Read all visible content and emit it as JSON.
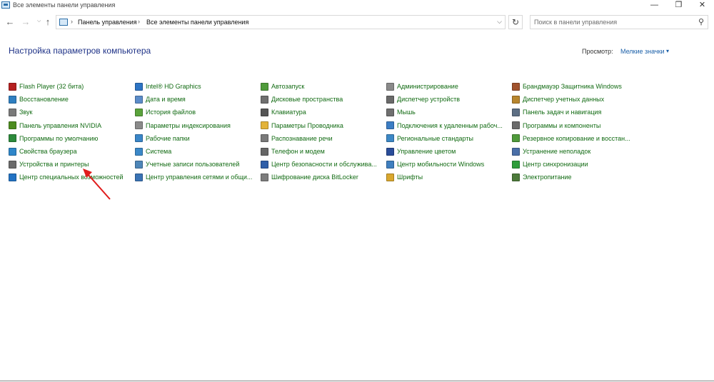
{
  "window": {
    "title": "Все элементы панели управления",
    "controls": {
      "minimize": "—",
      "maximize": "❐",
      "close": "✕"
    }
  },
  "nav": {
    "back": "←",
    "forward": "→",
    "recent": "⌵",
    "up": "↑"
  },
  "address": {
    "crumbs": [
      "Панель управления",
      "Все элементы панели управления"
    ],
    "separator": "›",
    "dropdown": "⌵",
    "refresh": "↻"
  },
  "search": {
    "placeholder": "Поиск в панели управления",
    "value": ""
  },
  "heading": "Настройка параметров компьютера",
  "view": {
    "label": "Просмотр:",
    "value": "Мелкие значки",
    "caret": "▾"
  },
  "columns": [
    {
      "items": [
        {
          "label": "Flash Player (32 бита)",
          "icon": "flash-icon",
          "color": "#b52020"
        },
        {
          "label": "Восстановление",
          "icon": "recovery-icon",
          "color": "#2f7fc1"
        },
        {
          "label": "Звук",
          "icon": "sound-icon",
          "color": "#7a7a7a"
        },
        {
          "label": "Панель управления NVIDIA",
          "icon": "nvidia-icon",
          "color": "#4c8c1f"
        },
        {
          "label": "Программы по умолчанию",
          "icon": "default-programs-icon",
          "color": "#2c8a3b"
        },
        {
          "label": "Свойства браузера",
          "icon": "browser-icon",
          "color": "#2e86c9"
        },
        {
          "label": "Устройства и принтеры",
          "icon": "printer-icon",
          "color": "#6b6b6b"
        },
        {
          "label": "Центр специальных возможностей",
          "icon": "accessibility-icon",
          "color": "#2272c3"
        }
      ]
    },
    {
      "items": [
        {
          "label": "Intel® HD Graphics",
          "icon": "intel-icon",
          "color": "#2d74c4"
        },
        {
          "label": "Дата и время",
          "icon": "clock-icon",
          "color": "#5b8cc9"
        },
        {
          "label": "История файлов",
          "icon": "file-history-icon",
          "color": "#5aa33b"
        },
        {
          "label": "Параметры индексирования",
          "icon": "indexing-icon",
          "color": "#8a8a8a"
        },
        {
          "label": "Рабочие папки",
          "icon": "work-folders-icon",
          "color": "#3a86c8"
        },
        {
          "label": "Система",
          "icon": "system-icon",
          "color": "#3b88c8"
        },
        {
          "label": "Учетные записи пользователей",
          "icon": "users-icon",
          "color": "#4e86b8"
        },
        {
          "label": "Центр управления сетями и общи...",
          "icon": "network-icon",
          "color": "#3a73b5"
        }
      ]
    },
    {
      "items": [
        {
          "label": "Автозапуск",
          "icon": "autoplay-icon",
          "color": "#4f9b3b"
        },
        {
          "label": "Дисковые пространства",
          "icon": "storage-icon",
          "color": "#6f6f6f"
        },
        {
          "label": "Клавиатура",
          "icon": "keyboard-icon",
          "color": "#555555"
        },
        {
          "label": "Параметры Проводника",
          "icon": "explorer-options-icon",
          "color": "#e3b33a"
        },
        {
          "label": "Распознавание речи",
          "icon": "microphone-icon",
          "color": "#7a7a7a"
        },
        {
          "label": "Телефон и модем",
          "icon": "phone-icon",
          "color": "#666666"
        },
        {
          "label": "Центр безопасности и обслужива...",
          "icon": "flag-icon",
          "color": "#2f5ea8"
        },
        {
          "label": "Шифрование диска BitLocker",
          "icon": "bitlocker-icon",
          "color": "#7d7d7d"
        }
      ]
    },
    {
      "items": [
        {
          "label": "Администрирование",
          "icon": "admin-tools-icon",
          "color": "#8a8a8a"
        },
        {
          "label": "Диспетчер устройств",
          "icon": "device-manager-icon",
          "color": "#6a6a6a"
        },
        {
          "label": "Мышь",
          "icon": "mouse-icon",
          "color": "#6f6f6f"
        },
        {
          "label": "Подключения к удаленным рабоч...",
          "icon": "remoteapp-icon",
          "color": "#3b7dc4"
        },
        {
          "label": "Региональные стандарты",
          "icon": "region-icon",
          "color": "#3c88c6"
        },
        {
          "label": "Управление цветом",
          "icon": "color-management-icon",
          "color": "#2a4d9a"
        },
        {
          "label": "Центр мобильности Windows",
          "icon": "mobility-icon",
          "color": "#3f7fbf"
        },
        {
          "label": "Шрифты",
          "icon": "fonts-icon",
          "color": "#d9a72e"
        }
      ]
    },
    {
      "items": [
        {
          "label": "Брандмауэр Защитника Windows",
          "icon": "firewall-icon",
          "color": "#a0522d"
        },
        {
          "label": "Диспетчер учетных данных",
          "icon": "credential-icon",
          "color": "#b8862e"
        },
        {
          "label": "Панель задач и навигация",
          "icon": "taskbar-icon",
          "color": "#5d6f84"
        },
        {
          "label": "Программы и компоненты",
          "icon": "programs-icon",
          "color": "#6b6b6b"
        },
        {
          "label": "Резервное копирование и восстан...",
          "icon": "backup-icon",
          "color": "#4f9a3a"
        },
        {
          "label": "Устранение неполадок",
          "icon": "troubleshoot-icon",
          "color": "#4a6fa8"
        },
        {
          "label": "Центр синхронизации",
          "icon": "sync-icon",
          "color": "#2e9d3b"
        },
        {
          "label": "Электропитание",
          "icon": "power-icon",
          "color": "#4c7a3a"
        }
      ]
    }
  ],
  "annotation": {
    "color": "#e01c1c"
  }
}
